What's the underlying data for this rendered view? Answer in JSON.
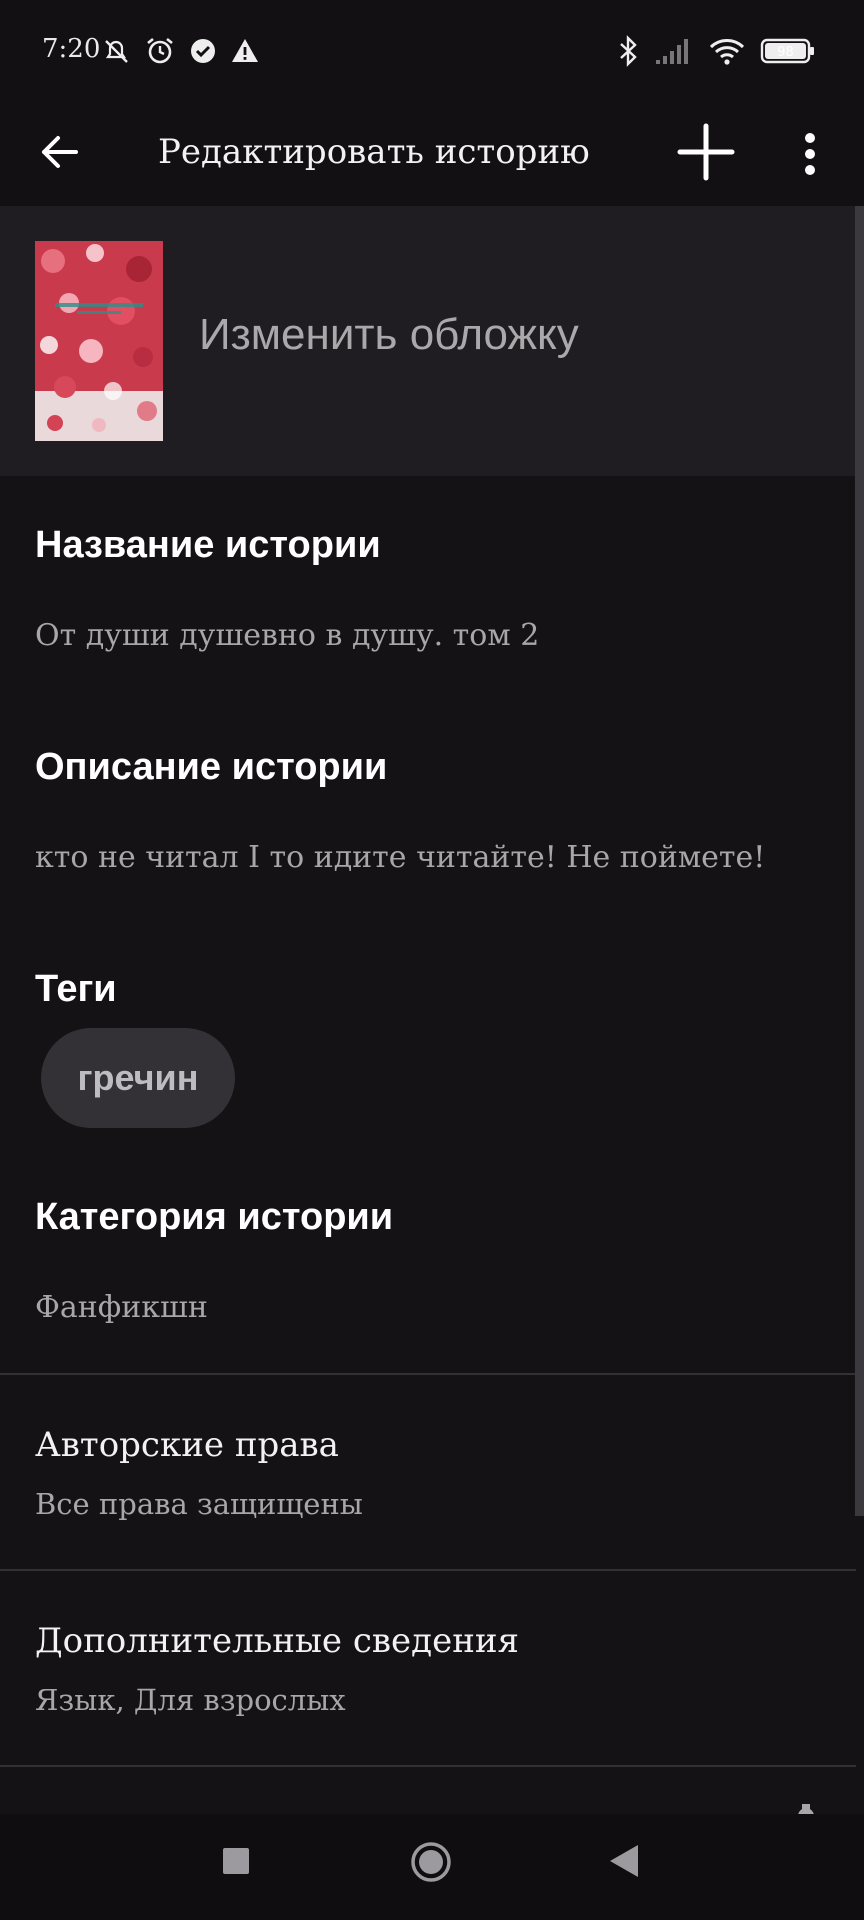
{
  "status_bar": {
    "time": "7:20",
    "battery": "98",
    "icons_left": [
      "mute-notifications-icon",
      "alarm-icon",
      "check-circle-icon",
      "warning-icon"
    ],
    "icons_right": [
      "bluetooth-icon",
      "signal-icon",
      "wifi-icon",
      "battery-icon"
    ]
  },
  "app_bar": {
    "title": "Редактировать историю",
    "back_icon": "arrow-left-icon",
    "add_icon": "plus-icon",
    "more_icon": "more-vert-icon"
  },
  "cover": {
    "label": "Изменить обложку"
  },
  "story_title": {
    "label": "Название истории",
    "value": "От души душевно в душу. том 2"
  },
  "story_description": {
    "label": "Описание истории",
    "value": "кто не читал I то идите читайте! Не поймете!"
  },
  "tags": {
    "label": "Теги",
    "items": [
      "гречин"
    ]
  },
  "category": {
    "label": "Категория истории",
    "value": "Фанфикшн"
  },
  "copyright": {
    "label": "Авторские права",
    "value": "Все права защищены"
  },
  "extra_info": {
    "label": "Дополнительные сведения",
    "value": "Язык, Для взрослых"
  },
  "nav_bar": {
    "icons": [
      "recent-apps-icon",
      "home-icon",
      "back-triangle-icon"
    ]
  },
  "colors": {
    "background": "#141215",
    "surface": "#1f1d21",
    "chip": "#333136",
    "text_primary": "#ffffff",
    "text_secondary": "#a7a6aa"
  }
}
